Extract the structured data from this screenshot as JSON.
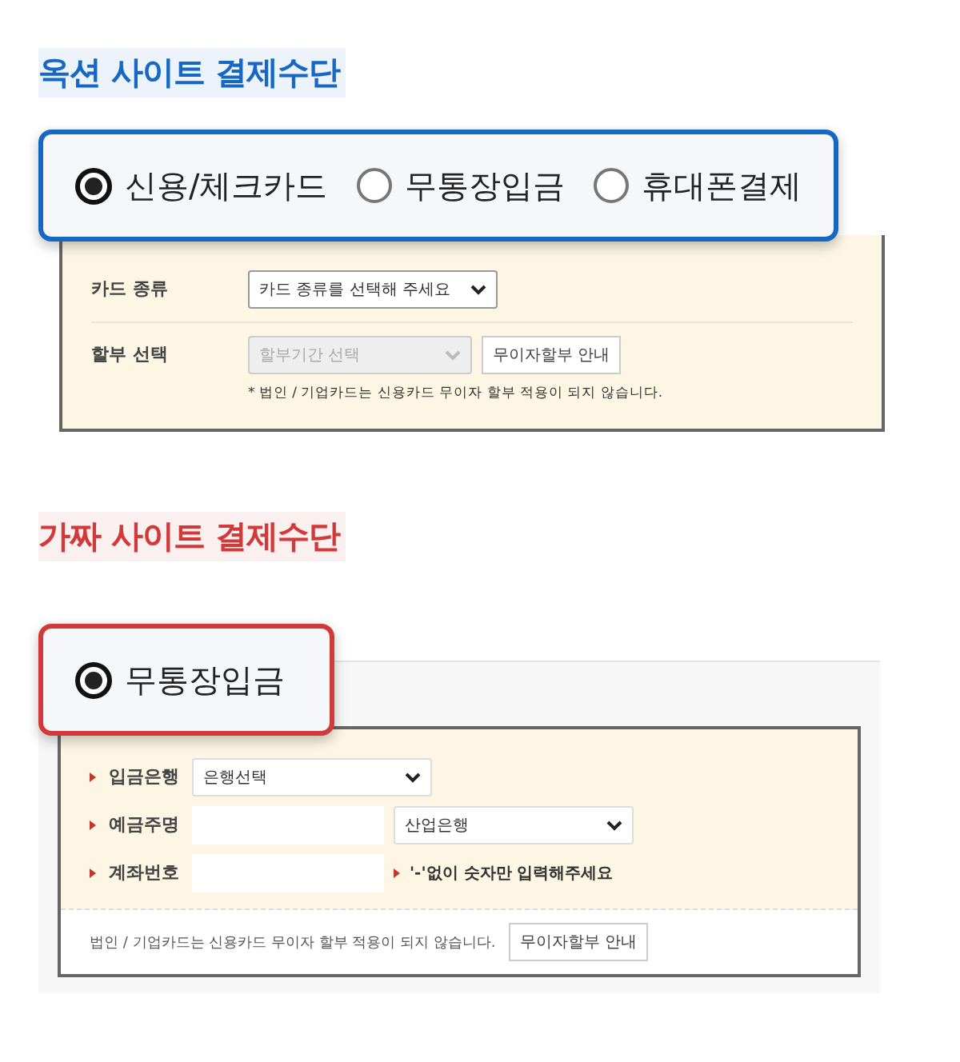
{
  "sections": [
    {
      "title": "옥션 사이트 결제수단",
      "color": "#1768c4",
      "kind": "plain",
      "methods": [
        {
          "label": "신용/체크카드",
          "selected": true
        },
        {
          "label": "무통장입금",
          "selected": false
        },
        {
          "label": "휴대폰결제",
          "selected": false
        }
      ],
      "rows": [
        {
          "label": "카드 종류",
          "required": false,
          "fields": [
            {
              "kind": "select",
              "text": "카드 종류를 선택해 주세요",
              "disabled": false
            }
          ]
        },
        {
          "label": "할부 선택",
          "required": false,
          "fields": [
            {
              "kind": "select",
              "text": "할부기간 선택",
              "disabled": true
            },
            {
              "kind": "button",
              "text": "무이자할부 안내"
            }
          ],
          "note": "* 법인 / 기업카드는 신용카드 무이자 할부 적용이 되지 않습니다."
        }
      ]
    },
    {
      "title": "가짜 사이트 결제수단",
      "color": "#d23a3a",
      "kind": "framed",
      "methods": [
        {
          "label": "무통장입금",
          "selected": true
        }
      ],
      "rows": [
        {
          "label": "입금은행",
          "required": true,
          "fields": [
            {
              "kind": "select",
              "text": "은행선택",
              "disabled": false
            }
          ]
        },
        {
          "label": "예금주명",
          "required": true,
          "fields": [
            {
              "kind": "input"
            },
            {
              "kind": "select",
              "text": "산업은행",
              "disabled": false
            }
          ]
        },
        {
          "label": "계좌번호",
          "required": true,
          "fields": [
            {
              "kind": "input"
            },
            {
              "kind": "hint",
              "text": "'-'없이 숫자만 입력해주세요"
            }
          ]
        }
      ],
      "footer": {
        "note": "법인 / 기업카드는 신용카드 무이자 할부 적용이 되지 않습니다.",
        "button": "무이자할부 안내"
      }
    }
  ]
}
